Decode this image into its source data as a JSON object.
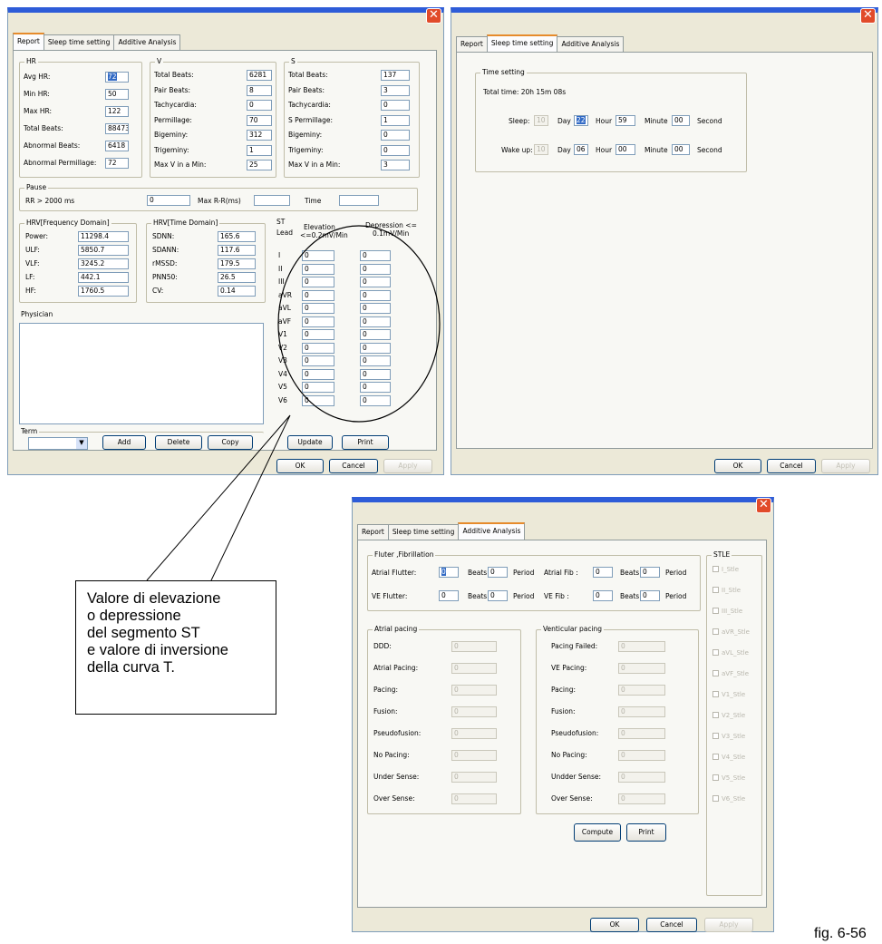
{
  "tabs": [
    "Report",
    "Sleep time setting",
    "Additive Analysis"
  ],
  "footer": {
    "ok": "OK",
    "cancel": "Cancel",
    "apply": "Apply"
  },
  "w1": {
    "hr": {
      "title": "HR",
      "rows": [
        {
          "label": "Avg HR:",
          "value": "72"
        },
        {
          "label": "Min HR:",
          "value": "50"
        },
        {
          "label": "Max HR:",
          "value": "122"
        },
        {
          "label": "Total Beats:",
          "value": "88473"
        },
        {
          "label": "Abnormal Beats:",
          "value": "6418"
        },
        {
          "label": "Abnormal Permillage:",
          "value": "72"
        }
      ]
    },
    "v": {
      "title": "V",
      "rows": [
        {
          "label": "Total Beats:",
          "value": "6281"
        },
        {
          "label": "Pair Beats:",
          "value": "8"
        },
        {
          "label": "Tachycardia:",
          "value": "0"
        },
        {
          "label": "Permillage:",
          "value": "70"
        },
        {
          "label": "Bigeminy:",
          "value": "312"
        },
        {
          "label": "Trigeminy:",
          "value": "1"
        },
        {
          "label": "Max V in a Min:",
          "value": "25"
        }
      ]
    },
    "s": {
      "title": "S",
      "rows": [
        {
          "label": "Total Beats:",
          "value": "137"
        },
        {
          "label": "Pair Beats:",
          "value": "3"
        },
        {
          "label": "Tachycardia:",
          "value": "0"
        },
        {
          "label": "S Permillage:",
          "value": "1"
        },
        {
          "label": "Bigeminy:",
          "value": "0"
        },
        {
          "label": "Trigeminy:",
          "value": "0"
        },
        {
          "label": "Max V in a Min:",
          "value": "3"
        }
      ]
    },
    "pause": {
      "title": "Pause",
      "rr_label": "RR > 2000 ms",
      "rr_value": "0",
      "max_label": "Max R-R(ms)",
      "max_value": "",
      "time_label": "Time",
      "time_value": ""
    },
    "hrvf": {
      "title": "HRV[Frequency Domain]",
      "rows": [
        {
          "label": "Power:",
          "value": "11298.4"
        },
        {
          "label": "ULF:",
          "value": "5850.7"
        },
        {
          "label": "VLF:",
          "value": "3245.2"
        },
        {
          "label": "LF:",
          "value": "442.1"
        },
        {
          "label": "HF:",
          "value": "1760.5"
        }
      ]
    },
    "hrvt": {
      "title": "HRV[Time Domain]",
      "rows": [
        {
          "label": "SDNN:",
          "value": "165.6"
        },
        {
          "label": "SDANN:",
          "value": "117.6"
        },
        {
          "label": "rMSSD:",
          "value": "179.5"
        },
        {
          "label": "PNN50:",
          "value": "26.5"
        },
        {
          "label": "CV:",
          "value": "0.14"
        }
      ]
    },
    "st": {
      "title": "ST",
      "lead": "Lead",
      "elev": "Elevation",
      "elev2": "<=0.2mV/Min",
      "dep": "Depression <=",
      "dep2": "0.1mV/Min",
      "leads": [
        {
          "lead": "I",
          "elev": "0",
          "dep": "0"
        },
        {
          "lead": "II",
          "elev": "0",
          "dep": "0"
        },
        {
          "lead": "III",
          "elev": "0",
          "dep": "0"
        },
        {
          "lead": "aVR",
          "elev": "0",
          "dep": "0"
        },
        {
          "lead": "aVL",
          "elev": "0",
          "dep": "0"
        },
        {
          "lead": "aVF",
          "elev": "0",
          "dep": "0"
        },
        {
          "lead": "V1",
          "elev": "0",
          "dep": "0"
        },
        {
          "lead": "V2",
          "elev": "0",
          "dep": "0"
        },
        {
          "lead": "V3",
          "elev": "0",
          "dep": "0"
        },
        {
          "lead": "V4",
          "elev": "0",
          "dep": "0"
        },
        {
          "lead": "V5",
          "elev": "0",
          "dep": "0"
        },
        {
          "lead": "V6",
          "elev": "0",
          "dep": "0"
        }
      ]
    },
    "physician": "Physician",
    "term": {
      "title": "Term",
      "add": "Add",
      "delete": "Delete",
      "copy": "Copy"
    },
    "update": "Update",
    "print": "Print"
  },
  "w2": {
    "group": "Time setting",
    "total": "Total time: 20h 15m 08s",
    "sleep_label": "Sleep:",
    "sleep_day": "10",
    "sleep_hour": "22",
    "sleep_minute": "59",
    "sleep_second": "00",
    "wake_label": "Wake up:",
    "wake_day": "10",
    "wake_hour": "06",
    "wake_minute": "00",
    "wake_second": "00",
    "day": "Day",
    "hour": "Hour",
    "minute": "Minute",
    "second": "Second"
  },
  "w3": {
    "flutter": {
      "title": "Fluter ,Fibrillation",
      "af_label": "Atrial Flutter:",
      "af_beats": "0",
      "af_period": "0",
      "afib_label": "Atrial Fib :",
      "afib_beats": "0",
      "afib_period": "0",
      "vf_label": "VE Flutter:",
      "vf_beats": "0",
      "vf_period": "0",
      "vfib_label": "VE Fib :",
      "vfib_beats": "0",
      "vfib_period": "0",
      "beats": "Beats",
      "period": "Period"
    },
    "atrial": {
      "title": "Atrial pacing",
      "rows": [
        {
          "label": "DDD:",
          "value": "0"
        },
        {
          "label": "Atrial Pacing:",
          "value": "0"
        },
        {
          "label": "Pacing:",
          "value": "0"
        },
        {
          "label": "Fusion:",
          "value": "0"
        },
        {
          "label": "Pseudofusion:",
          "value": "0"
        },
        {
          "label": "No Pacing:",
          "value": "0"
        },
        {
          "label": "Under Sense:",
          "value": "0"
        },
        {
          "label": "Over Sense:",
          "value": "0"
        }
      ]
    },
    "vent": {
      "title": "Venticular pacing",
      "rows": [
        {
          "label": "Pacing Failed:",
          "value": "0"
        },
        {
          "label": "VE Pacing:",
          "value": "0"
        },
        {
          "label": "Pacing:",
          "value": "0"
        },
        {
          "label": "Fusion:",
          "value": "0"
        },
        {
          "label": "Pseudofusion:",
          "value": "0"
        },
        {
          "label": "No Pacing:",
          "value": "0"
        },
        {
          "label": "Undder Sense:",
          "value": "0"
        },
        {
          "label": "Over Sense:",
          "value": "0"
        }
      ]
    },
    "stle": {
      "title": "STLE",
      "items": [
        "I_Stle",
        "II_Stle",
        "III_Stle",
        "aVR_Stle",
        "aVL_Stle",
        "aVF_Stle",
        "V1_Stle",
        "V2_Stle",
        "V3_Stle",
        "V4_Stle",
        "V5_Stle",
        "V6_Stle"
      ]
    },
    "compute": "Compute",
    "print": "Print"
  },
  "callout": [
    "Valore di elevazione",
    "o depressione",
    "del segmento ST",
    "e valore di inversione",
    "della curva T."
  ],
  "figure_label": "fig. 6-56"
}
